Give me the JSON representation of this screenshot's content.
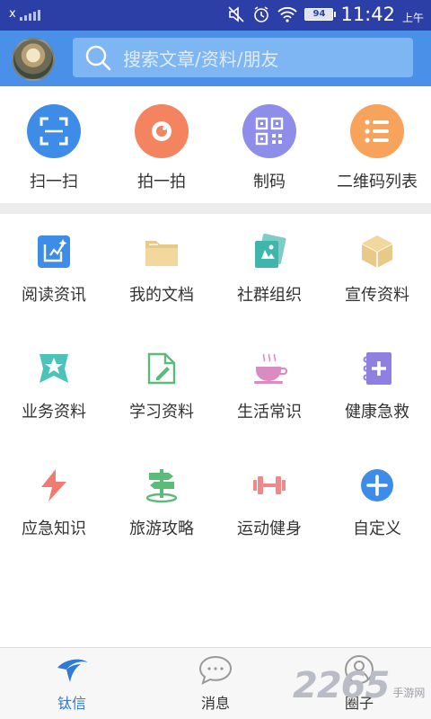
{
  "status_bar": {
    "carrier": "x",
    "time": "11:42",
    "ampm": "上午",
    "battery": "94",
    "icons": [
      "signal-icon",
      "mute-icon",
      "alarm-icon",
      "wifi-icon",
      "battery-icon"
    ]
  },
  "header": {
    "search_placeholder": "搜索文章/资料/朋友"
  },
  "quick_actions": [
    {
      "label": "扫一扫",
      "icon": "scan-icon",
      "color": "#3D8DE8"
    },
    {
      "label": "拍一拍",
      "icon": "camera-icon",
      "color": "#F4845F"
    },
    {
      "label": "制码",
      "icon": "qrcode-icon",
      "color": "#8E8EEA"
    },
    {
      "label": "二维码列表",
      "icon": "list-icon",
      "color": "#F7A35C"
    }
  ],
  "grid": [
    {
      "label": "阅读资讯",
      "icon": "reading-icon"
    },
    {
      "label": "我的文档",
      "icon": "folder-icon"
    },
    {
      "label": "社群组织",
      "icon": "community-icon"
    },
    {
      "label": "宣传资料",
      "icon": "box-icon"
    },
    {
      "label": "业务资料",
      "icon": "business-icon"
    },
    {
      "label": "学习资料",
      "icon": "study-icon"
    },
    {
      "label": "生活常识",
      "icon": "coffee-icon"
    },
    {
      "label": "健康急救",
      "icon": "health-icon"
    },
    {
      "label": "应急知识",
      "icon": "lightning-icon"
    },
    {
      "label": "旅游攻略",
      "icon": "signpost-icon"
    },
    {
      "label": "运动健身",
      "icon": "dumbbell-icon"
    },
    {
      "label": "自定义",
      "icon": "add-icon"
    }
  ],
  "tabs": [
    {
      "label": "钛信",
      "active": true
    },
    {
      "label": "消息",
      "active": false
    },
    {
      "label": "圈子",
      "active": false
    }
  ],
  "watermark": {
    "number": "2265",
    "text": "手游网"
  }
}
